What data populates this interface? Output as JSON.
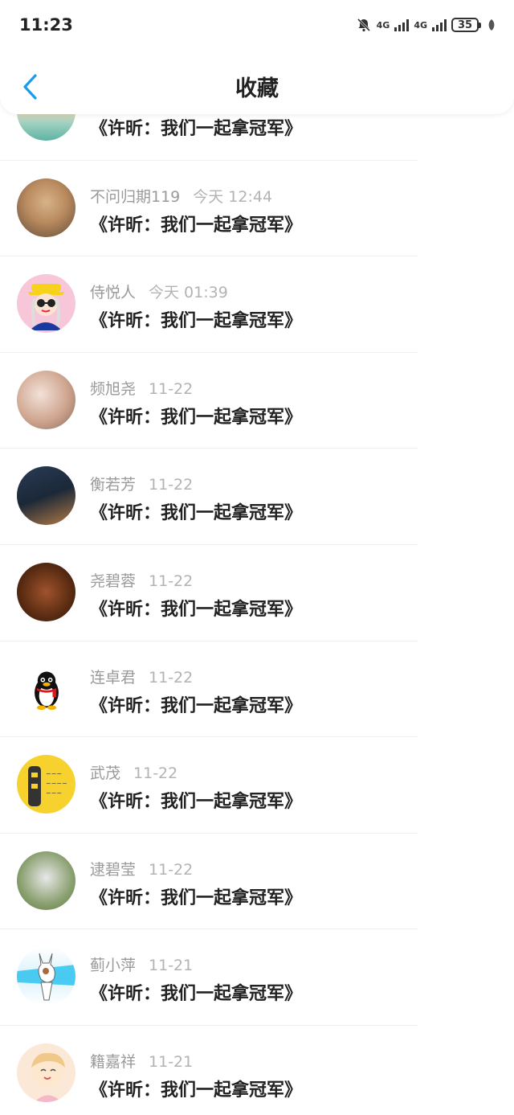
{
  "status_bar": {
    "time": "11:23",
    "battery": "35",
    "net1": "4G",
    "net2": "4G"
  },
  "nav": {
    "title": "收藏",
    "back_icon": "chevron-left-icon"
  },
  "items": [
    {
      "user": "",
      "time": "",
      "title": "《许昕：我们一起拿冠军》",
      "avatar_bg": "linear-gradient(180deg,#e9c9a0 0%,#f3d7b3 45%,#9fd0c0 70%,#5fb3a4 100%)",
      "avatar_icon": "sunset-photo-icon"
    },
    {
      "user": "不问归期119",
      "time": "今天 12:44",
      "title": "《许昕：我们一起拿冠军》",
      "avatar_bg": "radial-gradient(circle at 50% 40%,#d7b38a 0%,#b98a5e 45%,#5f4a3a 100%)",
      "avatar_icon": "shiba-dog-icon"
    },
    {
      "user": "侍悦人",
      "time": "今天 01:39",
      "title": "《许昕：我们一起拿冠军》",
      "avatar_bg": "#f7c6d9",
      "avatar_icon": "cartoon-girl-icon"
    },
    {
      "user": "频旭尧",
      "time": "11-22",
      "title": "《许昕：我们一起拿冠军》",
      "avatar_bg": "radial-gradient(circle at 40% 40%,#f3e1d8 0%,#cfa58f 55%,#8b6a5a 100%)",
      "avatar_icon": "girl-photo-icon"
    },
    {
      "user": "衡若芳",
      "time": "11-22",
      "title": "《许昕：我们一起拿冠军》",
      "avatar_bg": "linear-gradient(160deg,#2a3b55 0%,#1b2838 50%,#b47a45 100%)",
      "avatar_icon": "runner-photo-icon"
    },
    {
      "user": "尧碧蓉",
      "time": "11-22",
      "title": "《许昕：我们一起拿冠军》",
      "avatar_bg": "radial-gradient(circle at 50% 50%,#a0522d 0%,#5a2c12 60%,#2c1408 100%)",
      "avatar_icon": "violin-photo-icon"
    },
    {
      "user": "连卓君",
      "time": "11-22",
      "title": "《许昕：我们一起拿冠军》",
      "avatar_bg": "#ffffff",
      "avatar_icon": "qq-penguin-icon"
    },
    {
      "user": "武茂",
      "time": "11-22",
      "title": "《许昕：我们一起拿冠军》",
      "avatar_bg": "#f7d22e",
      "avatar_icon": "cartoon-sticker-icon"
    },
    {
      "user": "逮碧莹",
      "time": "11-22",
      "title": "《许昕：我们一起拿冠军》",
      "avatar_bg": "radial-gradient(circle at 50% 45%,#e8e8e8 0%,#8aa070 60%,#5c7a3f 100%)",
      "avatar_icon": "husky-dog-icon"
    },
    {
      "user": "蓟小萍",
      "time": "11-21",
      "title": "《许昕：我们一起拿冠军》",
      "avatar_bg": "linear-gradient(180deg,#ffffff 0%,#d9f2fb 50%,#ffffff 100%)",
      "avatar_icon": "anime-character-icon"
    },
    {
      "user": "籍嘉祥",
      "time": "11-21",
      "title": "《许昕：我们一起拿冠军》",
      "avatar_bg": "#fbe8d6",
      "avatar_icon": "cartoon-boy-icon"
    }
  ]
}
